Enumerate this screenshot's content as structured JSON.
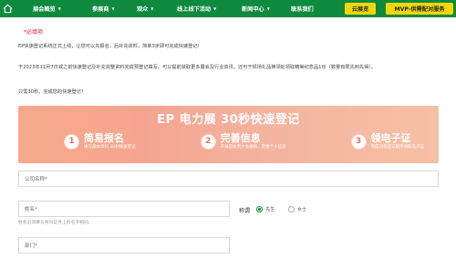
{
  "nav": {
    "items": [
      "展会概览",
      "参展商",
      "观众",
      "线上线下活动",
      "新闻中心",
      "联系我们"
    ],
    "btn_cloud": "云展览",
    "btn_mvp": "MVP-供需配对服务"
  },
  "notice": {
    "required": "*必填项",
    "line1": "EP快速登记系统正式上线，让您可以先报名，后补充资料，简单3步即可完成快速登记！",
    "line2": "于2023年11月7日或之前快速登记及补充完整资料完成预登记填写，可以提前获取更多展会及行业资讯，还可于现场礼品换领处领取精美纪念品1份（数量有限先到先得）。",
    "line3": "只需30秒，完成您的快速登记！"
  },
  "banner": {
    "title": "EP 电力展 30秒快速登记",
    "steps": [
      {
        "num": "1",
        "main": "简易报名",
        "sub": "填写基本资料 30秒快速登记"
      },
      {
        "num": "2",
        "main": "完善信息",
        "sub": "开展前收到大会通知，完善个人信息"
      },
      {
        "num": "3",
        "main": "领电子证",
        "sub": "完成问卷登记程序领取电子证"
      }
    ]
  },
  "form": {
    "company_placeholder": "公司名称*",
    "name_placeholder": "姓名*",
    "name_hint": "姓名必须要与身份证件上的名字相同。",
    "title_label": "称谓",
    "title_options": [
      "先生",
      "女士"
    ],
    "dept_placeholder": "部门*"
  },
  "colors": {
    "nav_bg": "#0e8a3e",
    "nav_btn": "#f5d60a",
    "required": "#e02020"
  }
}
